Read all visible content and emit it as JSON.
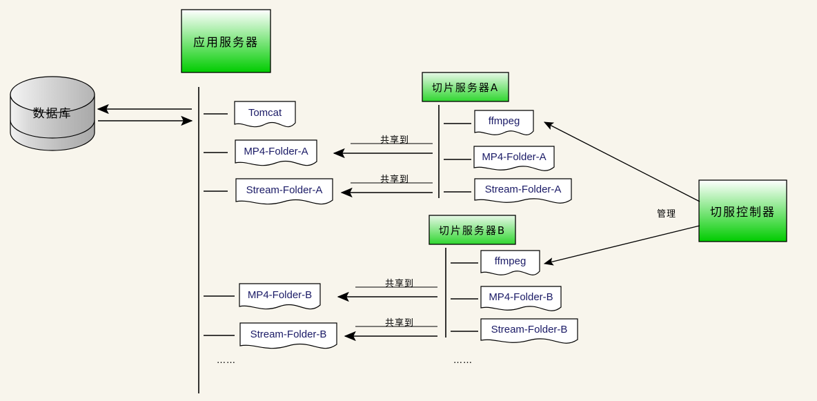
{
  "diagram": {
    "title_nodes": {
      "app_server": "应用服务器",
      "database": "数据库",
      "slice_server_a": "切片服务器A",
      "slice_server_b": "切片服务器B",
      "controller": "切服控制器"
    },
    "app_server_children": [
      {
        "label": "Tomcat"
      },
      {
        "label": "MP4-Folder-A"
      },
      {
        "label": "Stream-Folder-A"
      },
      {
        "label": "MP4-Folder-B"
      },
      {
        "label": "Stream-Folder-B"
      }
    ],
    "slice_server_a_children": [
      {
        "label": "ffmpeg"
      },
      {
        "label": "MP4-Folder-A"
      },
      {
        "label": "Stream-Folder-A"
      }
    ],
    "slice_server_b_children": [
      {
        "label": "ffmpeg"
      },
      {
        "label": "MP4-Folder-B"
      },
      {
        "label": "Stream-Folder-B"
      }
    ],
    "edge_labels": {
      "share_1": "共享到",
      "share_2": "共享到",
      "share_3": "共享到",
      "share_4": "共享到",
      "manage": "管理"
    },
    "ellipsis": {
      "left": "……",
      "right": "……"
    },
    "colors": {
      "background": "#f8f5ec",
      "green_dark": "#00cc00",
      "green_light": "#ffffff",
      "cylinder_fill": "#c0c0c0",
      "stroke": "#000000",
      "doc_text": "#1a1a66"
    }
  }
}
